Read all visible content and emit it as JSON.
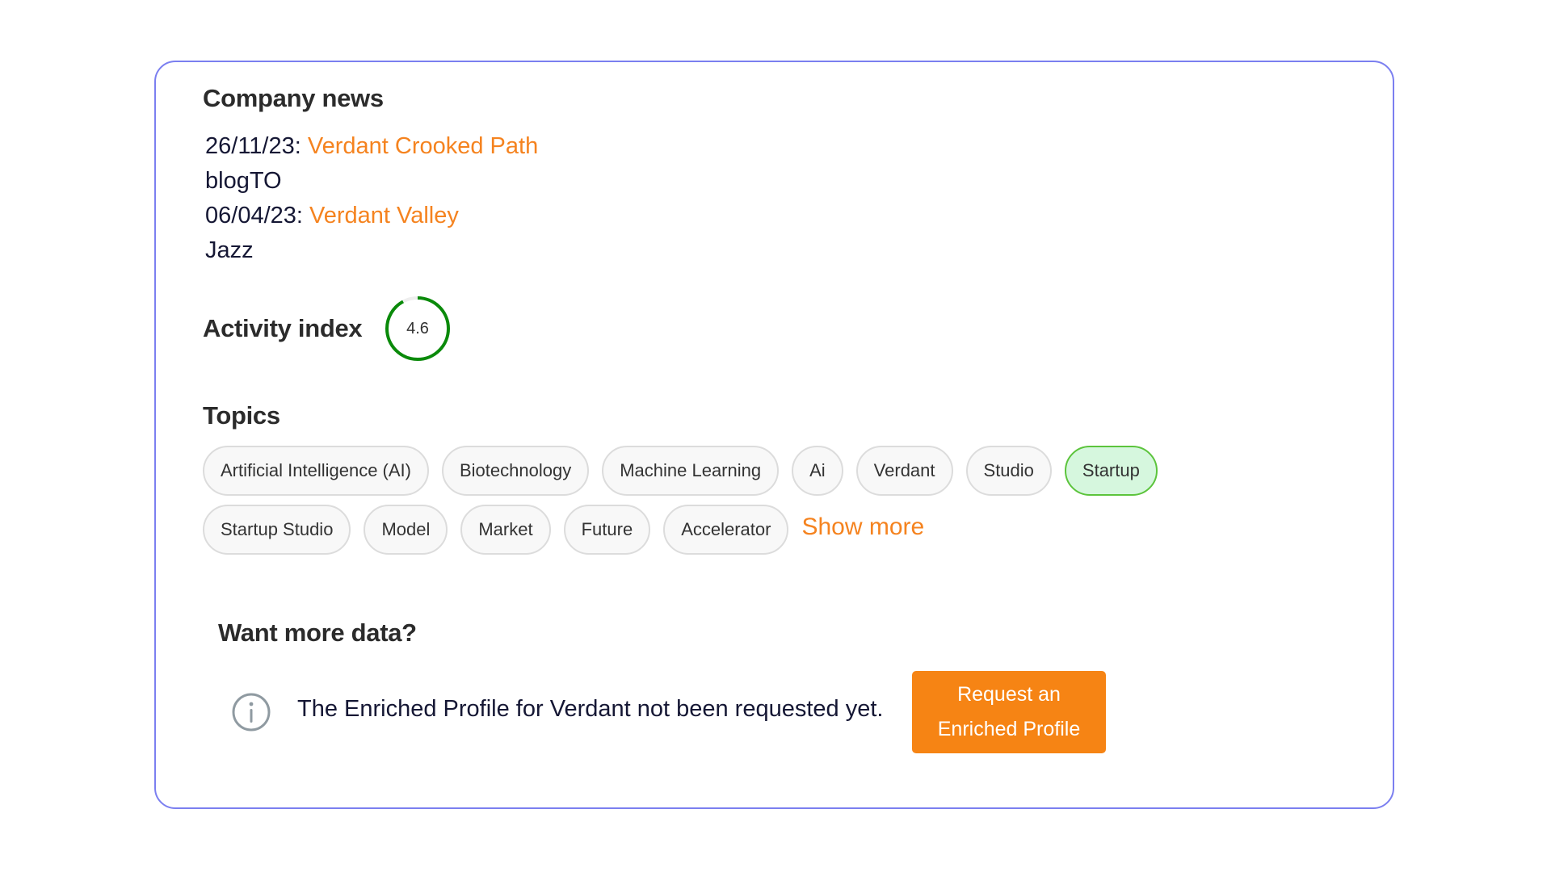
{
  "company_news": {
    "title": "Company news",
    "items": [
      {
        "date": "26/11/23:",
        "headline": "Verdant Crooked Path",
        "source": "blogTO"
      },
      {
        "date": "06/04/23:",
        "headline": "Verdant Valley",
        "source": "Jazz"
      }
    ]
  },
  "activity_index": {
    "label": "Activity index",
    "value": "4.6",
    "score": 4.6,
    "max": 5,
    "ring_color": "#0a8a0a",
    "track_color": "#eeeeee"
  },
  "topics": {
    "title": "Topics",
    "chips": [
      {
        "label": "Artificial Intelligence (AI)",
        "selected": false
      },
      {
        "label": "Biotechnology",
        "selected": false
      },
      {
        "label": "Machine Learning",
        "selected": false
      },
      {
        "label": "Ai",
        "selected": false
      },
      {
        "label": "Verdant",
        "selected": false
      },
      {
        "label": "Studio",
        "selected": false
      },
      {
        "label": "Startup",
        "selected": true
      },
      {
        "label": "Startup Studio",
        "selected": false
      },
      {
        "label": "Model",
        "selected": false
      },
      {
        "label": "Market",
        "selected": false
      },
      {
        "label": "Future",
        "selected": false
      },
      {
        "label": "Accelerator",
        "selected": false
      }
    ],
    "show_more_label": "Show more"
  },
  "enrichment": {
    "title": "Want more data?",
    "info_icon": "info-circle-icon",
    "message": "The Enriched Profile for Verdant not been requested yet.",
    "button_line1": "Request an",
    "button_line2": "Enriched Profile"
  },
  "colors": {
    "accent": "#f5831f",
    "button": "#f68414",
    "card_border": "#7b7ff0",
    "selected_chip_border": "#5cc43c",
    "selected_chip_bg": "#d6f7de"
  }
}
